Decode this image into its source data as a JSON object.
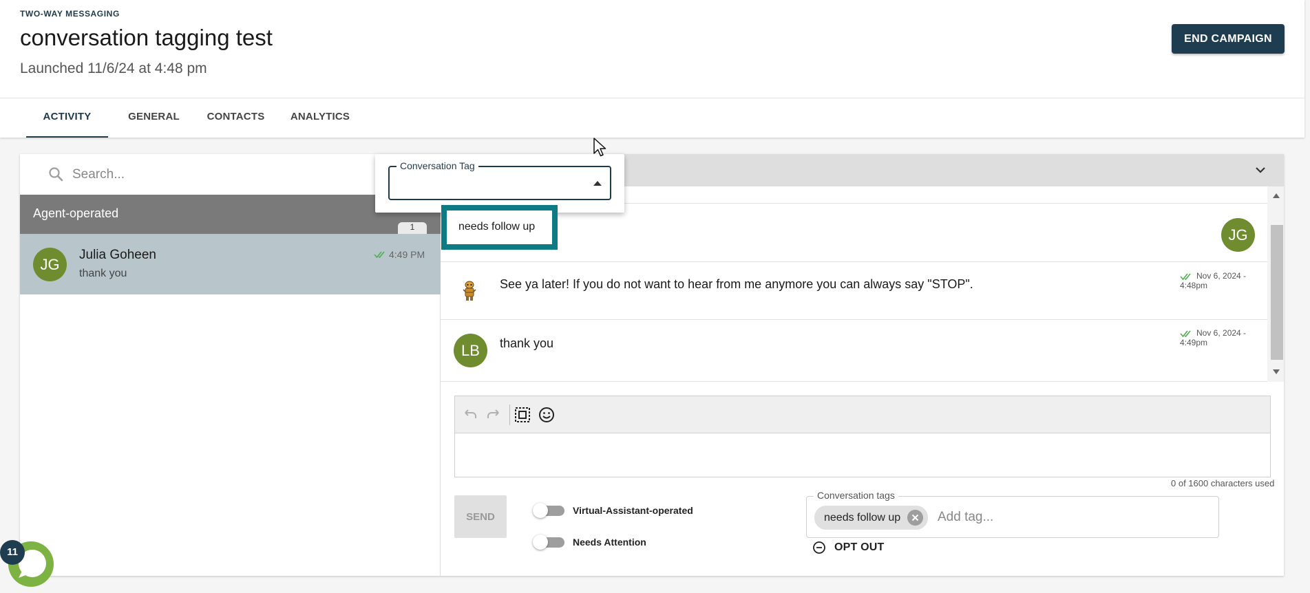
{
  "header": {
    "eyebrow": "TWO-WAY MESSAGING",
    "title": "conversation tagging test",
    "launched": "Launched 11/6/24 at 4:48 pm",
    "end_button": "END CAMPAIGN"
  },
  "tabs": [
    {
      "label": "ACTIVITY",
      "active": true
    },
    {
      "label": "GENERAL",
      "active": false
    },
    {
      "label": "CONTACTS",
      "active": false
    },
    {
      "label": "ANALYTICS",
      "active": false
    }
  ],
  "search": {
    "placeholder": "Search..."
  },
  "group": {
    "label": "Agent-operated",
    "count": "1"
  },
  "conversation": {
    "initials": "JG",
    "name": "Julia Goheen",
    "preview": "thank you",
    "time": "4:49 PM"
  },
  "messages": [
    {
      "avatar": "JG",
      "text": "",
      "timestamp": ""
    },
    {
      "avatar": "bot-icon",
      "text": "See ya later! If you do not want to hear from me anymore you can always say \"STOP\".",
      "timestamp": "Nov 6, 2024 - 4:48pm"
    },
    {
      "avatar": "LB",
      "text": "thank you",
      "timestamp": "Nov 6, 2024 - 4:49pm"
    }
  ],
  "composer": {
    "char_count": "0 of 1600 characters used",
    "send_label": "SEND"
  },
  "toggles": {
    "virtual_assistant": {
      "label": "Virtual-Assistant-operated",
      "on": false
    },
    "needs_attention": {
      "label": "Needs Attention",
      "on": false
    }
  },
  "conversation_tags": {
    "legend": "Conversation tags",
    "chips": [
      "needs follow up"
    ],
    "placeholder": "Add tag..."
  },
  "opt_out": {
    "label": "OPT OUT"
  },
  "tag_dropdown": {
    "legend": "Conversation Tag",
    "value": "",
    "options": [
      "needs follow up"
    ]
  },
  "chat_widget": {
    "badge": "11"
  },
  "colors": {
    "primary": "#1f3d50",
    "avatar_green": "#6f8c2e",
    "highlight_teal": "#0e7a83",
    "selected_row": "#b8c6cc",
    "group_header": "#7a7a7a"
  }
}
